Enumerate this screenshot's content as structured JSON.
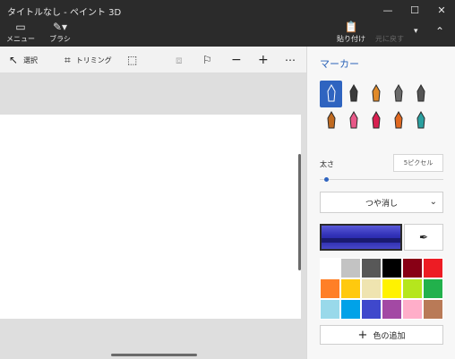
{
  "window": {
    "title": "タイトルなし - ペイント 3D",
    "minimize": "—",
    "maximize": "☐",
    "close": "✕"
  },
  "ribbon": {
    "menu": "メニュー",
    "brush": "ブラシ",
    "paste": "貼り付け",
    "undo": "元に戻す",
    "more": "▾",
    "collapse": "⌃"
  },
  "toolbar": {
    "select": "選択",
    "trim": "トリミング"
  },
  "panel": {
    "title": "マーカー",
    "size_label": "太さ",
    "size_value": "5ピクセル",
    "finish_value": "つや消し",
    "add_color": "色の追加",
    "selected_color": "#3535b5"
  },
  "tools": [
    {
      "name": "calligraphy-pen-icon",
      "color": "#1a1a1a",
      "selected": true
    },
    {
      "name": "oil-brush-icon",
      "color": "#3a3a3a"
    },
    {
      "name": "watercolor-brush-icon",
      "color": "#e08a2a"
    },
    {
      "name": "pixel-pen-icon",
      "color": "#6a6a6a"
    },
    {
      "name": "marker-icon",
      "color": "#555555"
    },
    {
      "name": "spacer",
      "color": ""
    },
    {
      "name": "pencil-icon",
      "color": "#c06a20"
    },
    {
      "name": "eraser-icon",
      "color": "#e85888"
    },
    {
      "name": "crayon-icon",
      "color": "#d82050"
    },
    {
      "name": "spray-can-icon",
      "color": "#e06820"
    },
    {
      "name": "fill-bucket-icon",
      "color": "#2aa0a0"
    }
  ],
  "palette": [
    "#ffffff",
    "#c3c3c3",
    "#585858",
    "#000000",
    "#880015",
    "#ed1c24",
    "#ff7f27",
    "#ffc90e",
    "#efe4b0",
    "#fff200",
    "#b5e61d",
    "#22b14c",
    "#99d9ea",
    "#00a2e8",
    "#3f48cc",
    "#a349a4",
    "#ffaec9",
    "#b97a57"
  ]
}
